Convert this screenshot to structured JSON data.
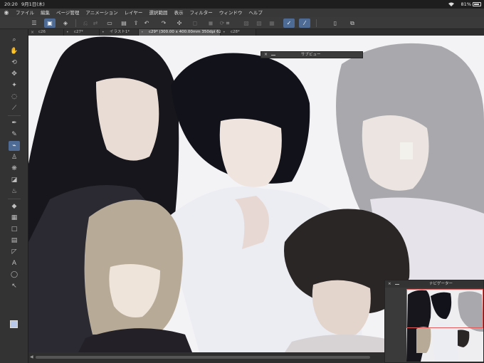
{
  "status_bar": {
    "time": "20:20",
    "date": "9月1日(木)",
    "battery_percent": "81%"
  },
  "menu": {
    "items": [
      "ファイル",
      "編集",
      "ページ管理",
      "アニメーション",
      "レイヤー",
      "選択範囲",
      "表示",
      "フィルター",
      "ウィンドウ",
      "ヘルプ"
    ]
  },
  "command_bar": {
    "icons": [
      "menu-icon",
      "new-canvas-icon",
      "clip-studio-icon",
      "undo-history-icon",
      "save-alt-icon",
      "open-file-icon",
      "save-icon",
      "export-icon",
      "undo-icon",
      "redo-icon",
      "transform-icon",
      "clear-icon",
      "fill-icon",
      "rotate-icon",
      "crop-icon",
      "deselect-icon",
      "invert-select-icon",
      "pen-stroke-icon",
      "vector-line-icon",
      "device-icon",
      "share-icon"
    ]
  },
  "tabs": [
    {
      "label": "c26",
      "active": false
    },
    {
      "label": "c27*",
      "active": false
    },
    {
      "label": "イラスト1*",
      "active": false
    },
    {
      "label": "c29* (300.00 x 400.00mm 350dpi 62.9%)",
      "active": true
    },
    {
      "label": "c28*",
      "active": false
    }
  ],
  "tools": [
    "zoom-icon",
    "hand-icon",
    "rotate-view-icon",
    "move-icon",
    "select-magic-icon",
    "lasso-icon",
    "eyedropper-icon",
    "pen-icon",
    "pencil-icon",
    "brush-icon",
    "airbrush-icon",
    "decoration-icon",
    "eraser-icon",
    "blend-icon",
    "fill-icon",
    "gradient-icon",
    "figure-icon",
    "frame-icon",
    "ruler-icon",
    "text-icon",
    "balloon-icon",
    "correction-icon"
  ],
  "colors": {
    "main_color": "#b8c8ea",
    "sub_color": "#111111",
    "accent": "#4d6b94"
  },
  "subview": {
    "title": "サブビュー"
  },
  "navigator": {
    "title": "ナビゲーター"
  }
}
